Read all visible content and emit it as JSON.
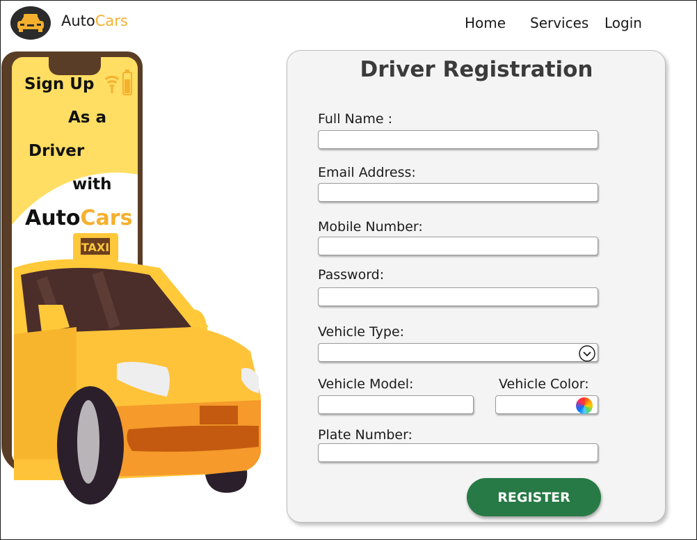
{
  "header": {
    "brand_part1": "Auto",
    "brand_part2": "Cars",
    "nav": [
      "Home",
      "Services",
      "Login"
    ]
  },
  "promo": {
    "line1": "Sign Up",
    "line2": "As a",
    "line3": "Driver",
    "line4": "with",
    "brand_part1": "Auto",
    "brand_part2": "Cars",
    "taxi_sign": "TAXI"
  },
  "form": {
    "title": "Driver Registration",
    "full_name_label": "Full Name :",
    "email_label": "Email Address:",
    "mobile_label": "Mobile Number:",
    "password_label": "Password:",
    "vehicle_type_label": "Vehicle Type:",
    "vehicle_model_label": "Vehicle Model:",
    "vehicle_color_label": "Vehicle Color:",
    "plate_label": "Plate Number:",
    "register_label": "REGISTER"
  },
  "colors": {
    "accent": "#f5b02e",
    "button": "#277a45",
    "phone_screen": "#ffde63"
  },
  "icons": [
    "car-logo-icon",
    "wifi-icon",
    "battery-icon",
    "chevron-down-icon",
    "color-wheel-icon",
    "taxi-illustration"
  ]
}
